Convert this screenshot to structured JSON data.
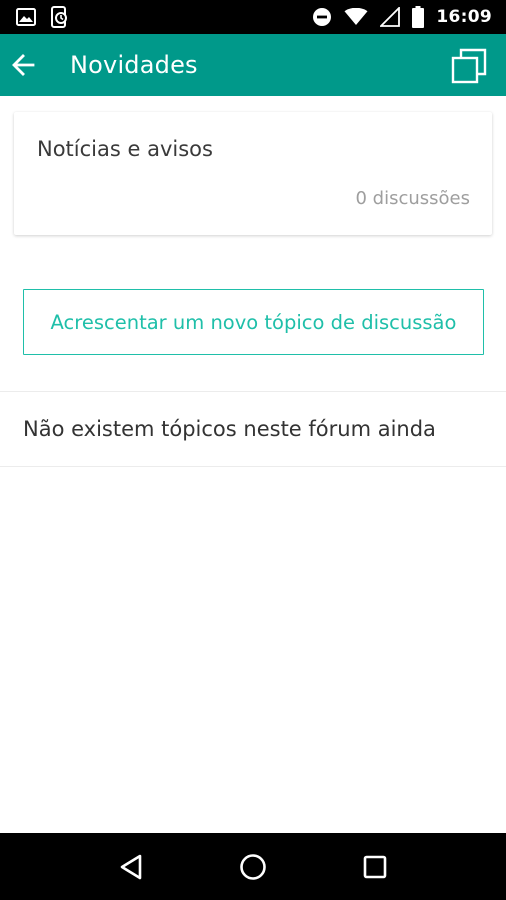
{
  "status_bar": {
    "time": "16:09",
    "left_icons": [
      "image-notification-icon",
      "sync-notification-icon"
    ],
    "right_icons": [
      "do-not-disturb-icon",
      "wifi-icon",
      "signal-icon",
      "battery-icon"
    ]
  },
  "app_bar": {
    "title": "Novidades",
    "background": "#00998a",
    "back_icon": "arrow-back-icon",
    "action_icon": "multi-window-icon"
  },
  "forum": {
    "title": "Notícias e avisos",
    "discussions": "0 discussões"
  },
  "actions": {
    "add_topic_label": "Acrescentar um novo tópico de discussão",
    "accent": "#1fbfa9"
  },
  "empty_state": {
    "message": "Não existem tópicos neste fórum ainda"
  },
  "nav_bar": {
    "icons": [
      "nav-back-icon",
      "nav-home-icon",
      "nav-recents-icon"
    ]
  }
}
